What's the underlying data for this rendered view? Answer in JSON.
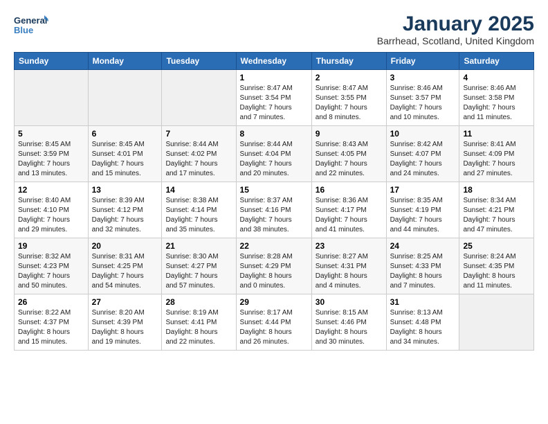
{
  "logo": {
    "line1": "General",
    "line2": "Blue"
  },
  "title": "January 2025",
  "subtitle": "Barrhead, Scotland, United Kingdom",
  "weekdays": [
    "Sunday",
    "Monday",
    "Tuesday",
    "Wednesday",
    "Thursday",
    "Friday",
    "Saturday"
  ],
  "weeks": [
    [
      {
        "day": "",
        "info": ""
      },
      {
        "day": "",
        "info": ""
      },
      {
        "day": "",
        "info": ""
      },
      {
        "day": "1",
        "info": "Sunrise: 8:47 AM\nSunset: 3:54 PM\nDaylight: 7 hours\nand 7 minutes."
      },
      {
        "day": "2",
        "info": "Sunrise: 8:47 AM\nSunset: 3:55 PM\nDaylight: 7 hours\nand 8 minutes."
      },
      {
        "day": "3",
        "info": "Sunrise: 8:46 AM\nSunset: 3:57 PM\nDaylight: 7 hours\nand 10 minutes."
      },
      {
        "day": "4",
        "info": "Sunrise: 8:46 AM\nSunset: 3:58 PM\nDaylight: 7 hours\nand 11 minutes."
      }
    ],
    [
      {
        "day": "5",
        "info": "Sunrise: 8:45 AM\nSunset: 3:59 PM\nDaylight: 7 hours\nand 13 minutes."
      },
      {
        "day": "6",
        "info": "Sunrise: 8:45 AM\nSunset: 4:01 PM\nDaylight: 7 hours\nand 15 minutes."
      },
      {
        "day": "7",
        "info": "Sunrise: 8:44 AM\nSunset: 4:02 PM\nDaylight: 7 hours\nand 17 minutes."
      },
      {
        "day": "8",
        "info": "Sunrise: 8:44 AM\nSunset: 4:04 PM\nDaylight: 7 hours\nand 20 minutes."
      },
      {
        "day": "9",
        "info": "Sunrise: 8:43 AM\nSunset: 4:05 PM\nDaylight: 7 hours\nand 22 minutes."
      },
      {
        "day": "10",
        "info": "Sunrise: 8:42 AM\nSunset: 4:07 PM\nDaylight: 7 hours\nand 24 minutes."
      },
      {
        "day": "11",
        "info": "Sunrise: 8:41 AM\nSunset: 4:09 PM\nDaylight: 7 hours\nand 27 minutes."
      }
    ],
    [
      {
        "day": "12",
        "info": "Sunrise: 8:40 AM\nSunset: 4:10 PM\nDaylight: 7 hours\nand 29 minutes."
      },
      {
        "day": "13",
        "info": "Sunrise: 8:39 AM\nSunset: 4:12 PM\nDaylight: 7 hours\nand 32 minutes."
      },
      {
        "day": "14",
        "info": "Sunrise: 8:38 AM\nSunset: 4:14 PM\nDaylight: 7 hours\nand 35 minutes."
      },
      {
        "day": "15",
        "info": "Sunrise: 8:37 AM\nSunset: 4:16 PM\nDaylight: 7 hours\nand 38 minutes."
      },
      {
        "day": "16",
        "info": "Sunrise: 8:36 AM\nSunset: 4:17 PM\nDaylight: 7 hours\nand 41 minutes."
      },
      {
        "day": "17",
        "info": "Sunrise: 8:35 AM\nSunset: 4:19 PM\nDaylight: 7 hours\nand 44 minutes."
      },
      {
        "day": "18",
        "info": "Sunrise: 8:34 AM\nSunset: 4:21 PM\nDaylight: 7 hours\nand 47 minutes."
      }
    ],
    [
      {
        "day": "19",
        "info": "Sunrise: 8:32 AM\nSunset: 4:23 PM\nDaylight: 7 hours\nand 50 minutes."
      },
      {
        "day": "20",
        "info": "Sunrise: 8:31 AM\nSunset: 4:25 PM\nDaylight: 7 hours\nand 54 minutes."
      },
      {
        "day": "21",
        "info": "Sunrise: 8:30 AM\nSunset: 4:27 PM\nDaylight: 7 hours\nand 57 minutes."
      },
      {
        "day": "22",
        "info": "Sunrise: 8:28 AM\nSunset: 4:29 PM\nDaylight: 8 hours\nand 0 minutes."
      },
      {
        "day": "23",
        "info": "Sunrise: 8:27 AM\nSunset: 4:31 PM\nDaylight: 8 hours\nand 4 minutes."
      },
      {
        "day": "24",
        "info": "Sunrise: 8:25 AM\nSunset: 4:33 PM\nDaylight: 8 hours\nand 7 minutes."
      },
      {
        "day": "25",
        "info": "Sunrise: 8:24 AM\nSunset: 4:35 PM\nDaylight: 8 hours\nand 11 minutes."
      }
    ],
    [
      {
        "day": "26",
        "info": "Sunrise: 8:22 AM\nSunset: 4:37 PM\nDaylight: 8 hours\nand 15 minutes."
      },
      {
        "day": "27",
        "info": "Sunrise: 8:20 AM\nSunset: 4:39 PM\nDaylight: 8 hours\nand 19 minutes."
      },
      {
        "day": "28",
        "info": "Sunrise: 8:19 AM\nSunset: 4:41 PM\nDaylight: 8 hours\nand 22 minutes."
      },
      {
        "day": "29",
        "info": "Sunrise: 8:17 AM\nSunset: 4:44 PM\nDaylight: 8 hours\nand 26 minutes."
      },
      {
        "day": "30",
        "info": "Sunrise: 8:15 AM\nSunset: 4:46 PM\nDaylight: 8 hours\nand 30 minutes."
      },
      {
        "day": "31",
        "info": "Sunrise: 8:13 AM\nSunset: 4:48 PM\nDaylight: 8 hours\nand 34 minutes."
      },
      {
        "day": "",
        "info": ""
      }
    ]
  ]
}
